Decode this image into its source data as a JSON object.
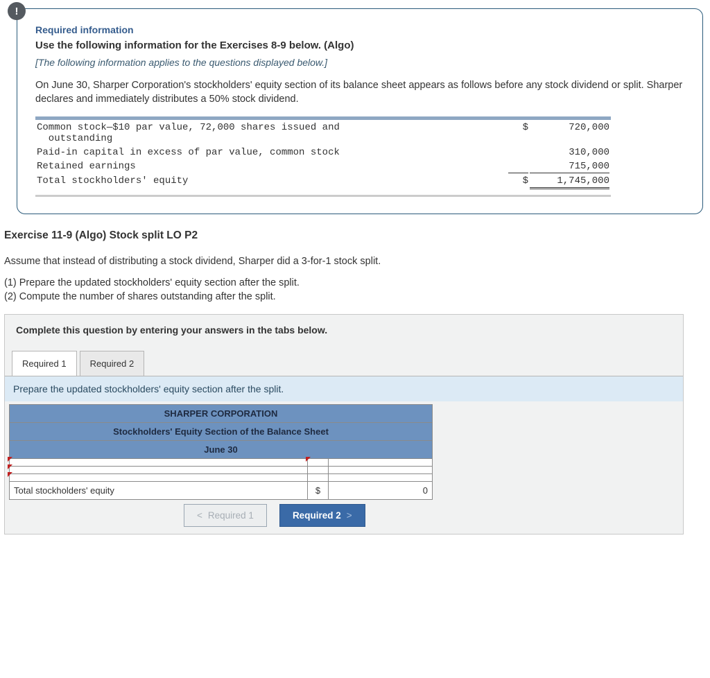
{
  "info_badge": "!",
  "required_label": "Required information",
  "use_following": "Use the following information for the Exercises 8-9 below. (Algo)",
  "applies_note": "[The following information applies to the questions displayed below.]",
  "scenario_para": "On June 30, Sharper Corporation's stockholders' equity section of its balance sheet appears as follows before any stock dividend or split. Sharper declares and immediately distributes a 50% stock dividend.",
  "equity": {
    "rows": [
      {
        "label": "Common stock—$10 par value, 72,000 shares issued and\n  outstanding",
        "sym": "$",
        "val": "720,000"
      },
      {
        "label": "Paid-in capital in excess of par value, common stock",
        "sym": "",
        "val": "310,000"
      },
      {
        "label": "Retained earnings",
        "sym": "",
        "val": "715,000"
      }
    ],
    "total": {
      "label": "Total stockholders' equity",
      "sym": "$",
      "val": "1,745,000"
    }
  },
  "exercise_heading": "Exercise 11-9 (Algo) Stock split LO P2",
  "assume_line": "Assume that instead of distributing a stock dividend, Sharper did a 3-for-1 stock split.",
  "req1": "(1) Prepare the updated stockholders' equity section after the split.",
  "req2": "(2) Compute the number of shares outstanding after the split.",
  "panel_instruction": "Complete this question by entering your answers in the tabs below.",
  "tabs": {
    "t1": "Required 1",
    "t2": "Required 2"
  },
  "tab1_prompt": "Prepare the updated stockholders' equity section after the split.",
  "answer_table": {
    "h1": "SHARPER CORPORATION",
    "h2": "Stockholders' Equity Section of the Balance Sheet",
    "h3": "June 30",
    "total_label": "Total stockholders' equity",
    "total_sym": "$",
    "total_val": "0"
  },
  "nav": {
    "prev": "Required 1",
    "prev_chev": "<",
    "next": "Required 2",
    "next_chev": ">"
  }
}
